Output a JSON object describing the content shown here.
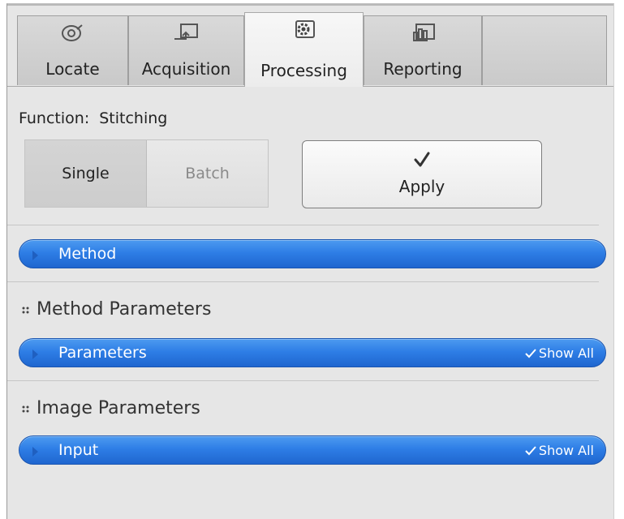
{
  "tabs": [
    {
      "label": "Locate",
      "icon": "locate-icon"
    },
    {
      "label": "Acquisition",
      "icon": "acquisition-icon"
    },
    {
      "label": "Processing",
      "icon": "processing-gear-icon",
      "active": true
    },
    {
      "label": "Reporting",
      "icon": "reporting-chart-icon"
    }
  ],
  "function": {
    "label": "Function:",
    "value": "Stitching"
  },
  "mode": {
    "single": "Single",
    "batch": "Batch",
    "selected": "Single"
  },
  "apply": {
    "label": "Apply",
    "icon": "checkmark-icon"
  },
  "sections": {
    "method_bar": {
      "label": "Method"
    },
    "method_parameters": {
      "title": "Method Parameters"
    },
    "parameters_bar": {
      "label": "Parameters",
      "show_all": "Show All"
    },
    "image_parameters": {
      "title": "Image Parameters"
    },
    "input_bar": {
      "label": "Input",
      "show_all": "Show All"
    }
  },
  "colors": {
    "accent_bar": "#2e7ee6",
    "panel_bg": "#e6e6e6"
  }
}
